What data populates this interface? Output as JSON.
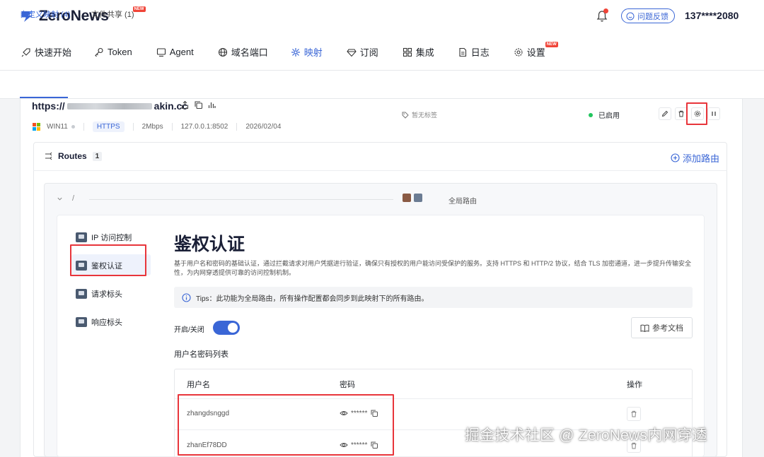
{
  "app": {
    "name": "ZeroNews",
    "user": "137****2080",
    "feedback": "问题反馈"
  },
  "nav": [
    {
      "label": "快速开始",
      "icon": "rocket-icon"
    },
    {
      "label": "Token",
      "icon": "key-icon"
    },
    {
      "label": "Agent",
      "icon": "monitor-icon"
    },
    {
      "label": "域名端口",
      "icon": "globe-icon"
    },
    {
      "label": "映射",
      "icon": "mapping-icon",
      "active": true
    },
    {
      "label": "订阅",
      "icon": "diamond-icon"
    },
    {
      "label": "集成",
      "icon": "grid-icon"
    },
    {
      "label": "日志",
      "icon": "document-icon"
    },
    {
      "label": "设置",
      "icon": "gear-icon",
      "badge": "NEW"
    }
  ],
  "subtabs": [
    {
      "label": "自定义映射 (4)",
      "active": true
    },
    {
      "label": "文件共享 (1)",
      "badge": "NEW"
    }
  ],
  "mapping": {
    "url_prefix": "https://",
    "url_suffix": "akin.cc",
    "os": "WIN11",
    "protocol": "HTTPS",
    "bandwidth": "2Mbps",
    "address": "127.0.0.1:8502",
    "date": "2026/02/04",
    "tag_hint": "暂无标签",
    "status": "已启用"
  },
  "routes": {
    "title": "Routes",
    "count": "1",
    "add_label": "添加路由",
    "path": "/",
    "global_label": "全局路由"
  },
  "sidebar": [
    {
      "label": "IP 访问控制"
    },
    {
      "label": "鉴权认证",
      "active": true
    },
    {
      "label": "请求标头"
    },
    {
      "label": "响应标头"
    }
  ],
  "auth": {
    "title": "鉴权认证",
    "description": "基于用户名和密码的基础认证，通过拦截请求对用户凭据进行验证，确保只有授权的用户能访问受保护的服务。支持 HTTPS 和 HTTP/2 协议，结合 TLS 加密通道，进一步提升传输安全性，为内网穿透提供可靠的访问控制机制。",
    "tips": "Tips：此功能为全局路由，所有操作配置都会同步到此映射下的所有路由。",
    "toggle_label": "开启/关闭",
    "toggle_on": true,
    "doc_button": "参考文档",
    "list_title": "用户名密码列表",
    "columns": {
      "user": "用户名",
      "password": "密码",
      "action": "操作"
    },
    "rows": [
      {
        "user": "zhangdsnggd",
        "password": "******"
      },
      {
        "user": "zhanEf78DD",
        "password": "******"
      }
    ]
  },
  "watermark": "掘金技术社区 @ ZeroNews内网穿透",
  "colors": {
    "accent": "#3a66d6",
    "highlight": "#e8353b",
    "enabled": "#22c55e"
  }
}
